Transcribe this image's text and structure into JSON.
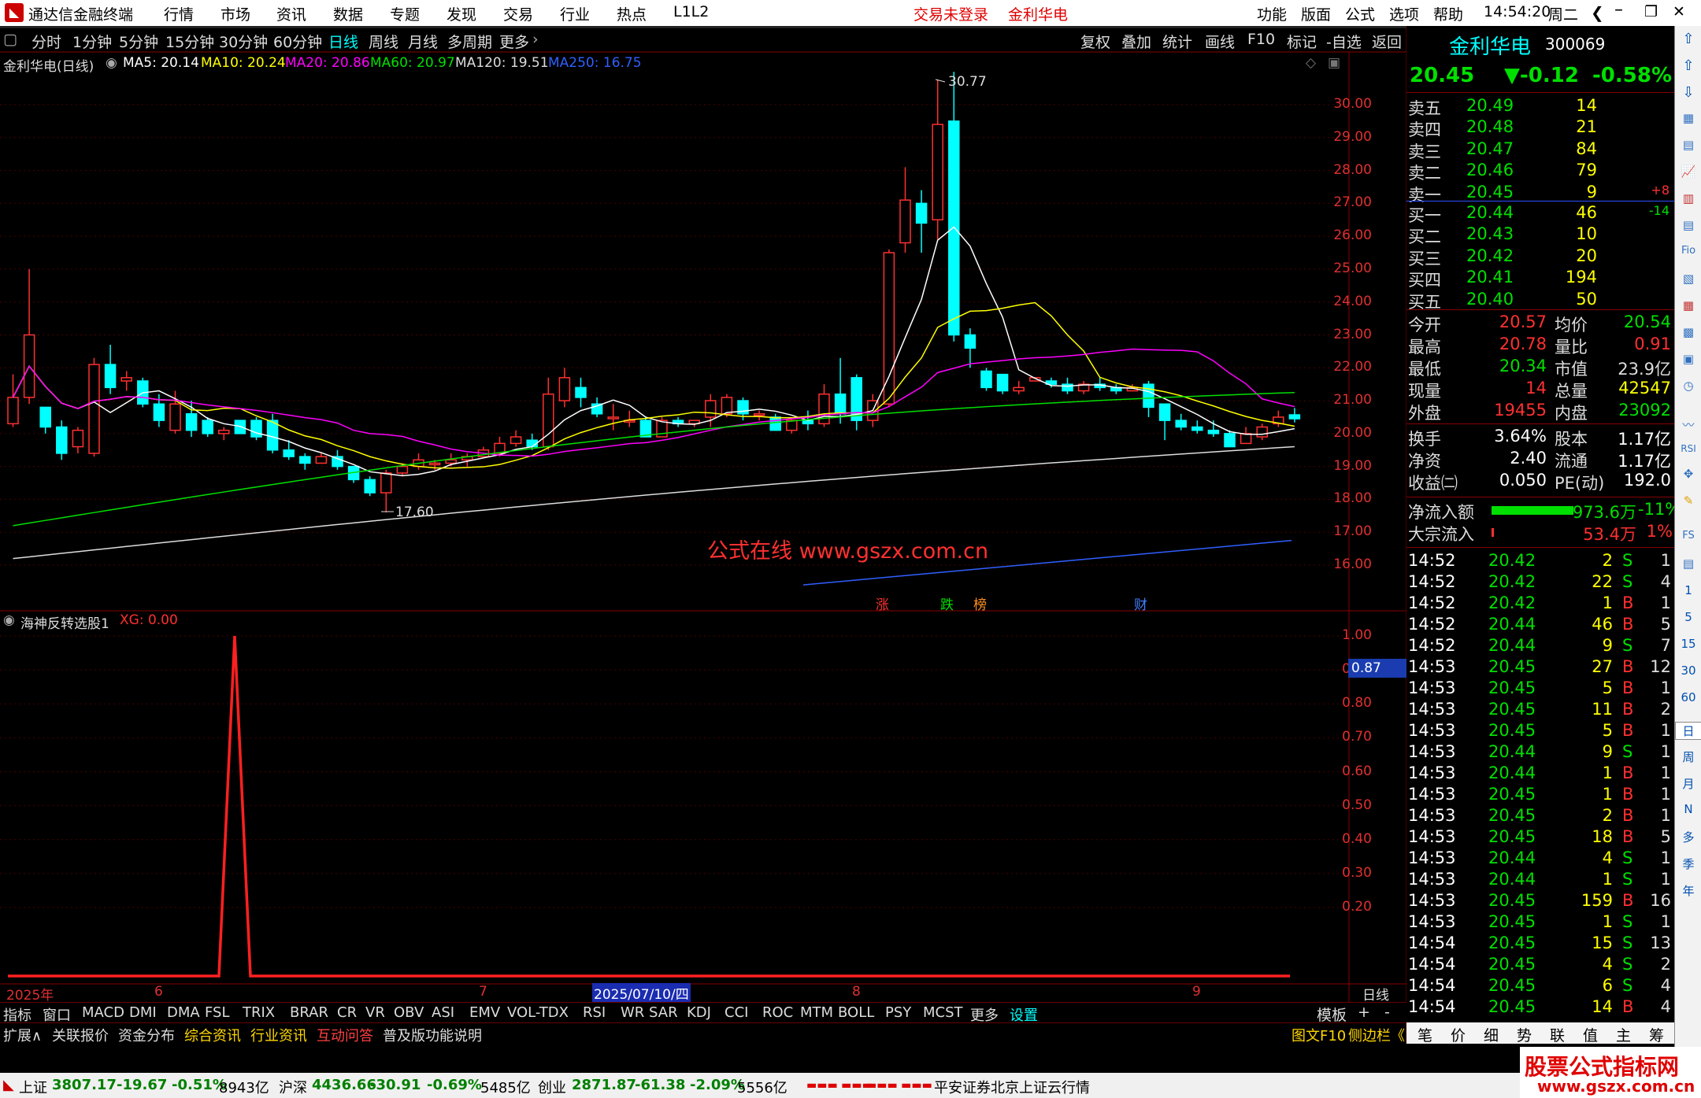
{
  "title": {
    "app": "通达信金融终端",
    "menus": [
      "行情",
      "市场",
      "资讯",
      "数据",
      "专题",
      "发现",
      "交易",
      "行业",
      "热点",
      "L1L2"
    ],
    "notice1": "交易未登录",
    "notice2": "金利华电",
    "menus_right": [
      "功能",
      "版面",
      "公式",
      "选项",
      "帮助"
    ],
    "time": "14:54:20",
    "weekday": "周二"
  },
  "periods": [
    "分时",
    "1分钟",
    "5分钟",
    "15分钟",
    "30分钟",
    "60分钟",
    "日线",
    "周线",
    "月线",
    "多周期",
    "更多"
  ],
  "tools": [
    "复权",
    "叠加",
    "统计",
    "画线",
    "F10",
    "标记",
    "-自选",
    "返回"
  ],
  "stock": {
    "name": "金利华电",
    "code": "300069",
    "price": "20.45",
    "change": "▼-0.12",
    "pct": "-0.58%"
  },
  "chart_header": {
    "name": "金利华电(日线)",
    "ma5": "MA5: 20.14",
    "ma10": "MA10: 20.24",
    "ma20": "MA20: 20.86",
    "ma60": "MA60: 20.97",
    "ma120": "MA120: 19.51",
    "ma250": "MA250: 16.75"
  },
  "chart_data": {
    "type": "candlestick",
    "y_ticks": [
      "30.00",
      "29.00",
      "28.00",
      "27.00",
      "26.00",
      "25.00",
      "24.00",
      "23.00",
      "22.00",
      "21.00",
      "20.00",
      "19.00",
      "18.00",
      "17.00",
      "16.00"
    ],
    "high_label": "30.77",
    "low_label": "17.60",
    "markers": [
      "涨",
      "跌",
      "榜",
      "财"
    ],
    "indicator": {
      "name": "海神反转选股1",
      "xg": "XG: 0.00",
      "y_ticks": [
        "1.00",
        "0.90",
        "0.80",
        "0.70",
        "0.60",
        "0.50",
        "0.40",
        "0.30",
        "0.20"
      ],
      "cursor_value": "0.87"
    },
    "x_labels": [
      "2025年",
      "6",
      "7",
      "2025/07/10/四",
      "8",
      "9"
    ],
    "period": "日线",
    "candles": [
      [
        20.3,
        21.1,
        20.2,
        21.8
      ],
      [
        21.1,
        23.0,
        20.9,
        25.0
      ],
      [
        20.8,
        20.2,
        20.0,
        20.6
      ],
      [
        20.2,
        19.4,
        19.2,
        20.4
      ],
      [
        19.6,
        20.1,
        19.4,
        20.2
      ],
      [
        19.4,
        22.1,
        19.3,
        22.3
      ],
      [
        22.1,
        21.4,
        21.2,
        22.7
      ],
      [
        21.6,
        21.7,
        21.3,
        21.9
      ],
      [
        21.6,
        20.9,
        20.8,
        21.7
      ],
      [
        20.9,
        20.4,
        20.2,
        21.2
      ],
      [
        20.1,
        20.9,
        20.0,
        21.3
      ],
      [
        20.6,
        20.1,
        19.9,
        21.0
      ],
      [
        20.4,
        20.0,
        19.9,
        20.5
      ],
      [
        20.0,
        20.1,
        19.8,
        20.2
      ],
      [
        20.4,
        20.0,
        20.0,
        20.4
      ],
      [
        20.4,
        19.9,
        19.8,
        20.5
      ],
      [
        20.4,
        19.5,
        19.4,
        20.6
      ],
      [
        19.5,
        19.3,
        19.2,
        19.8
      ],
      [
        19.3,
        19.1,
        18.9,
        19.4
      ],
      [
        19.1,
        19.3,
        19.1,
        19.4
      ],
      [
        19.3,
        19.0,
        18.9,
        19.5
      ],
      [
        19.0,
        18.6,
        18.5,
        19.0
      ],
      [
        18.6,
        18.2,
        18.1,
        18.7
      ],
      [
        18.2,
        18.8,
        17.6,
        18.9
      ],
      [
        18.8,
        19.0,
        18.7,
        19.1
      ],
      [
        19.0,
        19.2,
        18.9,
        19.4
      ],
      [
        19.1,
        19.1,
        18.9,
        19.2
      ],
      [
        19.1,
        19.2,
        19.0,
        19.4
      ],
      [
        19.2,
        19.3,
        19.0,
        19.4
      ],
      [
        19.3,
        19.5,
        19.3,
        19.6
      ],
      [
        19.4,
        19.7,
        19.3,
        19.9
      ],
      [
        19.7,
        19.9,
        19.6,
        20.1
      ],
      [
        19.8,
        19.6,
        19.5,
        20.0
      ],
      [
        19.6,
        21.2,
        19.5,
        21.7
      ],
      [
        21.0,
        21.7,
        20.8,
        22.0
      ],
      [
        21.4,
        21.1,
        20.8,
        21.7
      ],
      [
        20.9,
        20.6,
        20.5,
        21.1
      ],
      [
        20.5,
        20.5,
        20.1,
        20.9
      ],
      [
        20.4,
        20.4,
        20.2,
        20.7
      ],
      [
        20.4,
        19.9,
        19.9,
        20.5
      ],
      [
        19.9,
        20.4,
        19.9,
        20.5
      ],
      [
        20.4,
        20.3,
        20.2,
        20.5
      ],
      [
        20.3,
        20.4,
        20.2,
        20.4
      ],
      [
        20.5,
        21.0,
        20.2,
        21.2
      ],
      [
        20.6,
        21.1,
        20.5,
        21.2
      ],
      [
        21.0,
        20.6,
        20.4,
        21.1
      ],
      [
        20.6,
        20.6,
        20.4,
        20.7
      ],
      [
        20.5,
        20.1,
        20.1,
        20.6
      ],
      [
        20.1,
        20.4,
        20.0,
        20.5
      ],
      [
        20.4,
        20.3,
        20.1,
        20.7
      ],
      [
        20.3,
        21.2,
        20.2,
        21.5
      ],
      [
        21.2,
        20.6,
        20.3,
        22.3
      ],
      [
        21.7,
        20.4,
        20.1,
        21.8
      ],
      [
        20.4,
        21.0,
        20.2,
        21.2
      ],
      [
        20.9,
        25.5,
        20.8,
        25.6
      ],
      [
        25.8,
        27.1,
        25.5,
        28.1
      ],
      [
        27.0,
        26.4,
        25.5,
        27.4
      ],
      [
        26.5,
        29.4,
        25.9,
        30.77
      ],
      [
        29.5,
        23.0,
        22.8,
        31.0
      ],
      [
        23.0,
        22.6,
        22.0,
        23.2
      ],
      [
        21.9,
        21.4,
        21.3,
        22.0
      ],
      [
        21.8,
        21.3,
        21.2,
        21.8
      ],
      [
        21.3,
        21.4,
        21.2,
        21.6
      ],
      [
        21.6,
        21.7,
        21.6,
        21.7
      ],
      [
        21.6,
        21.5,
        21.4,
        21.7
      ],
      [
        21.5,
        21.3,
        21.2,
        21.7
      ],
      [
        21.3,
        21.5,
        21.2,
        21.6
      ],
      [
        21.5,
        21.4,
        21.3,
        21.7
      ],
      [
        21.4,
        21.3,
        21.2,
        21.5
      ],
      [
        21.3,
        21.4,
        21.3,
        21.5
      ],
      [
        21.5,
        20.8,
        20.5,
        21.6
      ],
      [
        20.9,
        20.4,
        19.8,
        20.8
      ],
      [
        20.4,
        20.2,
        20.1,
        20.6
      ],
      [
        20.2,
        20.1,
        20.0,
        20.4
      ],
      [
        20.1,
        20.0,
        19.9,
        20.4
      ],
      [
        20.0,
        19.6,
        19.6,
        20.1
      ],
      [
        19.7,
        20.0,
        19.7,
        20.2
      ],
      [
        19.9,
        20.2,
        19.8,
        20.3
      ],
      [
        20.3,
        20.5,
        20.2,
        20.7
      ],
      [
        20.57,
        20.45,
        20.34,
        20.78
      ]
    ],
    "ma_series": [
      {
        "name": "MA5",
        "color": "#ffffff"
      },
      {
        "name": "MA10",
        "color": "#ffff00"
      },
      {
        "name": "MA20",
        "color": "#ff00ff"
      },
      {
        "name": "MA60",
        "color": "#00e000"
      },
      {
        "name": "MA120",
        "color": "#dddddd"
      },
      {
        "name": "MA250",
        "color": "#3060ff"
      }
    ]
  },
  "watermark": "公式在线 www.gszx.com.cn",
  "order_book": {
    "asks": [
      {
        "label": "卖五",
        "price": "20.49",
        "vol": "14",
        "chg": ""
      },
      {
        "label": "卖四",
        "price": "20.48",
        "vol": "21",
        "chg": ""
      },
      {
        "label": "卖三",
        "price": "20.47",
        "vol": "84",
        "chg": ""
      },
      {
        "label": "卖二",
        "price": "20.46",
        "vol": "79",
        "chg": ""
      },
      {
        "label": "卖一",
        "price": "20.45",
        "vol": "9",
        "chg": "+8"
      }
    ],
    "bids": [
      {
        "label": "买一",
        "price": "20.44",
        "vol": "46",
        "chg": "-14"
      },
      {
        "label": "买二",
        "price": "20.43",
        "vol": "10",
        "chg": ""
      },
      {
        "label": "买三",
        "price": "20.42",
        "vol": "20",
        "chg": ""
      },
      {
        "label": "买四",
        "price": "20.41",
        "vol": "194",
        "chg": ""
      },
      {
        "label": "买五",
        "price": "20.40",
        "vol": "50",
        "chg": ""
      }
    ]
  },
  "stats": [
    [
      "今开",
      "20.57",
      "均价",
      "20.54"
    ],
    [
      "最高",
      "20.78",
      "量比",
      "0.91"
    ],
    [
      "最低",
      "20.34",
      "市值",
      "23.9亿"
    ],
    [
      "现量",
      "14",
      "总量",
      "42547"
    ],
    [
      "外盘",
      "19455",
      "内盘",
      "23092"
    ]
  ],
  "stats2": [
    [
      "换手",
      "3.64%",
      "股本",
      "1.17亿"
    ],
    [
      "净资",
      "2.40",
      "流通",
      "1.17亿"
    ],
    [
      "收益㈡",
      "0.050",
      "PE(动)",
      "192.0"
    ]
  ],
  "flow": [
    {
      "label": "净流入额",
      "val": "-973.6万",
      "pct": "-11%"
    },
    {
      "label": "大宗流入",
      "val": "53.4万",
      "pct": "1%"
    }
  ],
  "ticks": [
    [
      "14:52",
      "20.42",
      "2",
      "S",
      "1"
    ],
    [
      "14:52",
      "20.42",
      "22",
      "S",
      "4"
    ],
    [
      "14:52",
      "20.42",
      "1",
      "B",
      "1"
    ],
    [
      "14:52",
      "20.44",
      "46",
      "B",
      "5"
    ],
    [
      "14:52",
      "20.44",
      "9",
      "S",
      "7"
    ],
    [
      "14:53",
      "20.45",
      "27",
      "B",
      "12"
    ],
    [
      "14:53",
      "20.45",
      "5",
      "B",
      "1"
    ],
    [
      "14:53",
      "20.45",
      "11",
      "B",
      "2"
    ],
    [
      "14:53",
      "20.45",
      "5",
      "B",
      "1"
    ],
    [
      "14:53",
      "20.44",
      "9",
      "S",
      "1"
    ],
    [
      "14:53",
      "20.44",
      "1",
      "B",
      "1"
    ],
    [
      "14:53",
      "20.45",
      "1",
      "B",
      "1"
    ],
    [
      "14:53",
      "20.45",
      "2",
      "B",
      "1"
    ],
    [
      "14:53",
      "20.45",
      "18",
      "B",
      "5"
    ],
    [
      "14:53",
      "20.44",
      "4",
      "S",
      "1"
    ],
    [
      "14:53",
      "20.44",
      "1",
      "S",
      "1"
    ],
    [
      "14:53",
      "20.45",
      "159",
      "B",
      "16"
    ],
    [
      "14:53",
      "20.45",
      "1",
      "S",
      "1"
    ],
    [
      "14:54",
      "20.45",
      "15",
      "S",
      "13"
    ],
    [
      "14:54",
      "20.45",
      "4",
      "S",
      "2"
    ],
    [
      "14:54",
      "20.45",
      "6",
      "S",
      "4"
    ],
    [
      "14:54",
      "20.45",
      "14",
      "B",
      "4"
    ]
  ],
  "right_tabs": [
    "笔",
    "价",
    "细",
    "势",
    "联",
    "值",
    "主",
    "筹"
  ],
  "indicator_tabs": [
    "指标",
    "窗口",
    "MACD",
    "DMI",
    "DMA",
    "FSL",
    "TRIX",
    "BRAR",
    "CR",
    "VR",
    "OBV",
    "ASI",
    "EMV",
    "VOL-TDX",
    "RSI",
    "WR",
    "SAR",
    "KDJ",
    "CCI",
    "ROC",
    "MTM",
    "BOLL",
    "PSY",
    "MCST",
    "更多",
    "设置"
  ],
  "template_btns": [
    "模板",
    "+",
    "-"
  ],
  "bottom_tabs": [
    "扩展∧",
    "关联报价",
    "资金分布",
    "综合资讯",
    "行业资讯",
    "互动问答",
    "普及版功能说明"
  ],
  "bottom_right": [
    "图文F10",
    "侧边栏《"
  ],
  "sidebar": [
    "日",
    "周",
    "月",
    "N",
    "多",
    "季",
    "年",
    "RSI",
    "FS",
    "1",
    "5",
    "15",
    "30",
    "60",
    "Fio"
  ],
  "status": {
    "sh_name": "上证",
    "sh": "3807.17",
    "sh_chg": "-19.67",
    "sh_pct": "-0.51%",
    "sh_amt": "8943亿",
    "sz_name": "沪深",
    "sz": "4436.66",
    "sz_chg": "-30.91",
    "sz_pct": "-0.69%",
    "sz_amt": "5485亿",
    "cy_name": "创业",
    "cy": "2871.87",
    "cy_chg": "-61.38",
    "cy_pct": "-2.09%",
    "cy_amt": "5556亿",
    "broker": "平安证券北京上证云行情",
    "brand": "股票公式指标网",
    "brand_url": "www.gszx.com.cn"
  }
}
